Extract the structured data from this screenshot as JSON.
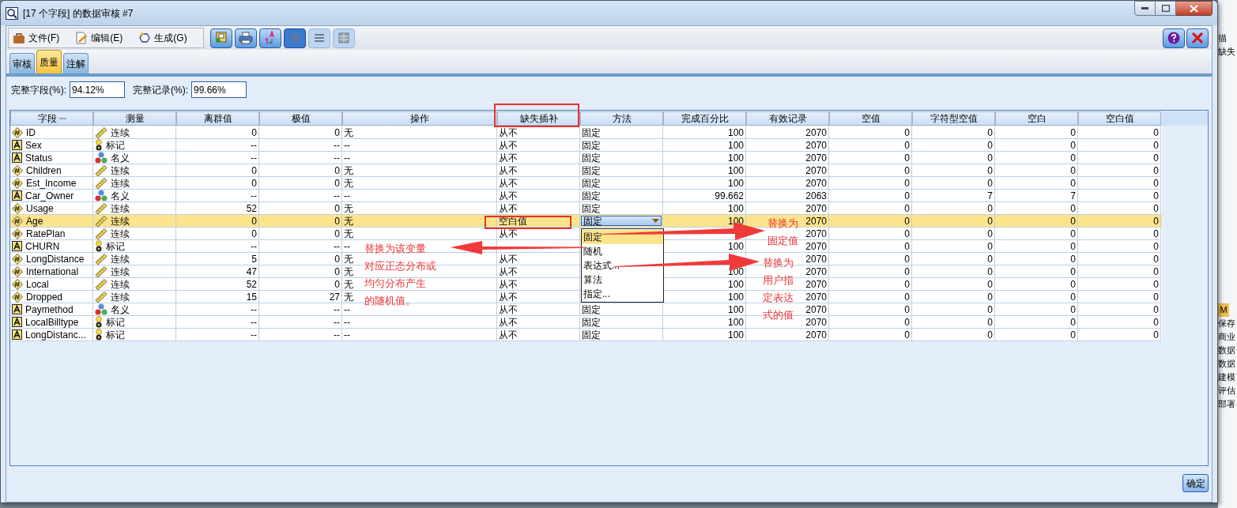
{
  "window": {
    "title": "[17 个字段] 的数据审核 #7"
  },
  "menu": [
    "文件(F)",
    "编辑(E)",
    "生成(G)"
  ],
  "toolbar": [
    {
      "kind": "generate"
    },
    {
      "kind": "print"
    },
    {
      "kind": "sort"
    },
    {
      "kind": "columns",
      "selected": true
    },
    {
      "kind": "rows",
      "selected": false
    },
    {
      "kind": "grid",
      "selected": false
    }
  ],
  "tabs": [
    {
      "label": "审核",
      "selected": false
    },
    {
      "label": "质量",
      "selected": true
    },
    {
      "label": "注解",
      "selected": false
    }
  ],
  "summary": [
    {
      "label": "完整字段(%):",
      "value": "94.12%"
    },
    {
      "label": "完整记录(%):",
      "value": "99.66%"
    }
  ],
  "table": {
    "columns": [
      "字段",
      "测量",
      "离群值",
      "极值",
      "操作",
      "缺失插补",
      "方法",
      "完成百分比",
      "有效记录",
      "空值",
      "字符型空值",
      "空白",
      "空白值"
    ],
    "rows": [
      {
        "field": {
          "name": "ID",
          "kind": "number"
        },
        "measure": {
          "label": "连续",
          "kind": "continuous"
        },
        "outliers": "0",
        "extremes": "0",
        "action": "无",
        "impute": "从不",
        "method": "固定",
        "complete": "100",
        "valid": "2070",
        "null": "0",
        "empty_string": "0",
        "whitespace": "0",
        "blank": "0",
        "selected": false
      },
      {
        "field": {
          "name": "Sex",
          "kind": "string"
        },
        "measure": {
          "label": "标记",
          "kind": "flag"
        },
        "outliers": "--",
        "extremes": "--",
        "action": "--",
        "impute": "从不",
        "method": "固定",
        "complete": "100",
        "valid": "2070",
        "null": "0",
        "empty_string": "0",
        "whitespace": "0",
        "blank": "0",
        "selected": false
      },
      {
        "field": {
          "name": "Status",
          "kind": "string"
        },
        "measure": {
          "label": "名义",
          "kind": "nominal"
        },
        "outliers": "--",
        "extremes": "--",
        "action": "--",
        "impute": "从不",
        "method": "固定",
        "complete": "100",
        "valid": "2070",
        "null": "0",
        "empty_string": "0",
        "whitespace": "0",
        "blank": "0",
        "selected": false
      },
      {
        "field": {
          "name": "Children",
          "kind": "number"
        },
        "measure": {
          "label": "连续",
          "kind": "continuous"
        },
        "outliers": "0",
        "extremes": "0",
        "action": "无",
        "impute": "从不",
        "method": "固定",
        "complete": "100",
        "valid": "2070",
        "null": "0",
        "empty_string": "0",
        "whitespace": "0",
        "blank": "0",
        "selected": false
      },
      {
        "field": {
          "name": "Est_Income",
          "kind": "number"
        },
        "measure": {
          "label": "连续",
          "kind": "continuous"
        },
        "outliers": "0",
        "extremes": "0",
        "action": "无",
        "impute": "从不",
        "method": "固定",
        "complete": "100",
        "valid": "2070",
        "null": "0",
        "empty_string": "0",
        "whitespace": "0",
        "blank": "0",
        "selected": false
      },
      {
        "field": {
          "name": "Car_Owner",
          "kind": "string"
        },
        "measure": {
          "label": "名义",
          "kind": "nominal"
        },
        "outliers": "--",
        "extremes": "--",
        "action": "--",
        "impute": "从不",
        "method": "固定",
        "complete": "99.662",
        "valid": "2063",
        "null": "0",
        "empty_string": "7",
        "whitespace": "7",
        "blank": "0",
        "selected": false
      },
      {
        "field": {
          "name": "Usage",
          "kind": "number"
        },
        "measure": {
          "label": "连续",
          "kind": "continuous"
        },
        "outliers": "52",
        "extremes": "0",
        "action": "无",
        "impute": "从不",
        "method": "固定",
        "complete": "100",
        "valid": "2070",
        "null": "0",
        "empty_string": "0",
        "whitespace": "0",
        "blank": "0",
        "selected": false
      },
      {
        "field": {
          "name": "Age",
          "kind": "number"
        },
        "measure": {
          "label": "连续",
          "kind": "continuous"
        },
        "outliers": "0",
        "extremes": "0",
        "action": "无",
        "impute": "空白值",
        "method": "固定",
        "complete": "100",
        "valid": "2070",
        "null": "0",
        "empty_string": "0",
        "whitespace": "0",
        "blank": "0",
        "selected": true
      },
      {
        "field": {
          "name": "RatePlan",
          "kind": "number"
        },
        "measure": {
          "label": "连续",
          "kind": "continuous"
        },
        "outliers": "0",
        "extremes": "0",
        "action": "无",
        "impute": "从不",
        "valid": "2070",
        "null": "0",
        "empty_string": "0",
        "whitespace": "0",
        "blank": "0",
        "selected": false
      },
      {
        "field": {
          "name": "CHURN",
          "kind": "string"
        },
        "measure": {
          "label": "标记",
          "kind": "flag"
        },
        "outliers": "--",
        "extremes": "--",
        "action": "--",
        "complete": "100",
        "valid": "2070",
        "null": "0",
        "empty_string": "0",
        "whitespace": "0",
        "blank": "0",
        "selected": false
      },
      {
        "field": {
          "name": "LongDistance",
          "kind": "number"
        },
        "measure": {
          "label": "连续",
          "kind": "continuous"
        },
        "outliers": "5",
        "extremes": "0",
        "action": "无",
        "impute": "从不",
        "valid": "2070",
        "null": "0",
        "empty_string": "0",
        "whitespace": "0",
        "blank": "0",
        "selected": false
      },
      {
        "field": {
          "name": "International",
          "kind": "number"
        },
        "measure": {
          "label": "连续",
          "kind": "continuous"
        },
        "outliers": "47",
        "extremes": "0",
        "action": "无",
        "impute": "从不",
        "complete": "100",
        "valid": "2070",
        "null": "0",
        "empty_string": "0",
        "whitespace": "0",
        "blank": "0",
        "selected": false
      },
      {
        "field": {
          "name": "Local",
          "kind": "number"
        },
        "measure": {
          "label": "连续",
          "kind": "continuous"
        },
        "outliers": "52",
        "extremes": "0",
        "action": "无",
        "impute": "从不",
        "complete": "100",
        "valid": "2070",
        "null": "0",
        "empty_string": "0",
        "whitespace": "0",
        "blank": "0",
        "selected": false
      },
      {
        "field": {
          "name": "Dropped",
          "kind": "number"
        },
        "measure": {
          "label": "连续",
          "kind": "continuous"
        },
        "outliers": "15",
        "extremes": "27",
        "action": "无",
        "impute": "从不",
        "complete": "100",
        "valid": "2070",
        "null": "0",
        "empty_string": "0",
        "whitespace": "0",
        "blank": "0",
        "selected": false
      },
      {
        "field": {
          "name": "Paymethod",
          "kind": "string"
        },
        "measure": {
          "label": "名义",
          "kind": "nominal"
        },
        "outliers": "--",
        "extremes": "--",
        "action": "--",
        "impute": "从不",
        "method": "固定",
        "complete": "100",
        "valid": "2070",
        "null": "0",
        "empty_string": "0",
        "whitespace": "0",
        "blank": "0",
        "selected": false
      },
      {
        "field": {
          "name": "LocalBilltype",
          "kind": "string"
        },
        "measure": {
          "label": "标记",
          "kind": "flag"
        },
        "outliers": "--",
        "extremes": "--",
        "action": "--",
        "impute": "从不",
        "method": "固定",
        "complete": "100",
        "valid": "2070",
        "null": "0",
        "empty_string": "0",
        "whitespace": "0",
        "blank": "0",
        "selected": false
      },
      {
        "field": {
          "name": "LongDistanc...",
          "kind": "string"
        },
        "measure": {
          "label": "标记",
          "kind": "flag"
        },
        "outliers": "--",
        "extremes": "--",
        "action": "--",
        "impute": "从不",
        "method": "固定",
        "complete": "100",
        "valid": "2070",
        "null": "0",
        "empty_string": "0",
        "whitespace": "0",
        "blank": "0",
        "selected": false
      }
    ]
  },
  "method_dropdown": {
    "options": [
      {
        "label": "固定",
        "selected": true
      },
      {
        "label": "随机",
        "selected": false
      },
      {
        "label": "表达式...",
        "selected": false
      },
      {
        "label": "算法",
        "selected": false
      },
      {
        "label": "指定...",
        "selected": false
      }
    ]
  },
  "annotations": [
    {
      "lines": [
        "替换为该变量",
        "对应正态分布或",
        "均匀分布产生",
        "的随机值。"
      ]
    },
    {
      "lines": [
        "替换为",
        "固定值"
      ]
    },
    {
      "lines": [
        "替换为",
        "用户指",
        "定表达",
        "式的值"
      ]
    }
  ],
  "ok_button": "确定",
  "background_window": {
    "items": [
      "描",
      "缺失",
      "M",
      "保存",
      "商业",
      "数据",
      "数据",
      "建模",
      "评估",
      "部署"
    ]
  }
}
